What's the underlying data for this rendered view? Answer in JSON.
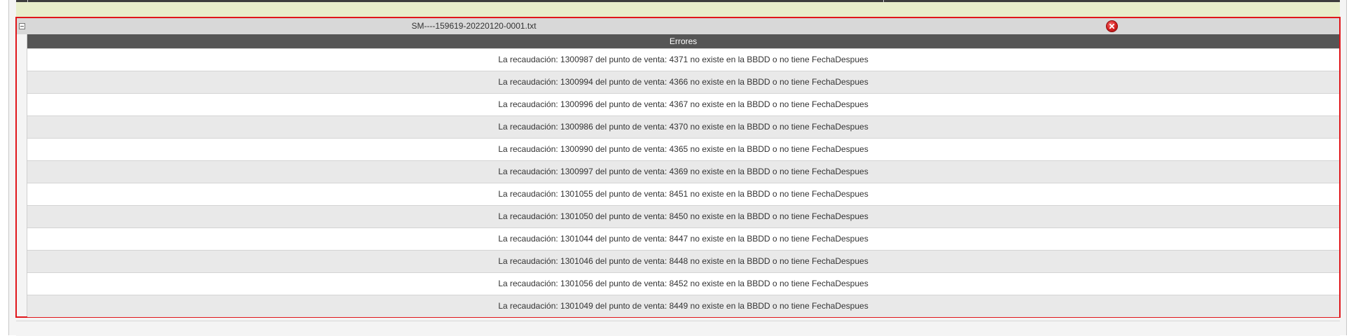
{
  "file_group": {
    "file_name": "SM----159619-20220120-0001.txt",
    "toggle_icon": "collapse-minus-icon",
    "delete_icon": "close-circle-icon",
    "accent_color": "#e0161b"
  },
  "errors": {
    "header": "Errores",
    "rows": [
      "La recaudación: 1300987 del punto de venta: 4371 no existe en la BBDD o no tiene FechaDespues",
      "La recaudación: 1300994 del punto de venta: 4366 no existe en la BBDD o no tiene FechaDespues",
      "La recaudación: 1300996 del punto de venta: 4367 no existe en la BBDD o no tiene FechaDespues",
      "La recaudación: 1300986 del punto de venta: 4370 no existe en la BBDD o no tiene FechaDespues",
      "La recaudación: 1300990 del punto de venta: 4365 no existe en la BBDD o no tiene FechaDespues",
      "La recaudación: 1300997 del punto de venta: 4369 no existe en la BBDD o no tiene FechaDespues",
      "La recaudación: 1301055 del punto de venta: 8451 no existe en la BBDD o no tiene FechaDespues",
      "La recaudación: 1301050 del punto de venta: 8450 no existe en la BBDD o no tiene FechaDespues",
      "La recaudación: 1301044 del punto de venta: 8447 no existe en la BBDD o no tiene FechaDespues",
      "La recaudación: 1301046 del punto de venta: 8448 no existe en la BBDD o no tiene FechaDespues",
      "La recaudación: 1301056 del punto de venta: 8452 no existe en la BBDD o no tiene FechaDespues",
      "La recaudación: 1301049 del punto de venta: 8449 no existe en la BBDD o no tiene FechaDespues"
    ]
  }
}
